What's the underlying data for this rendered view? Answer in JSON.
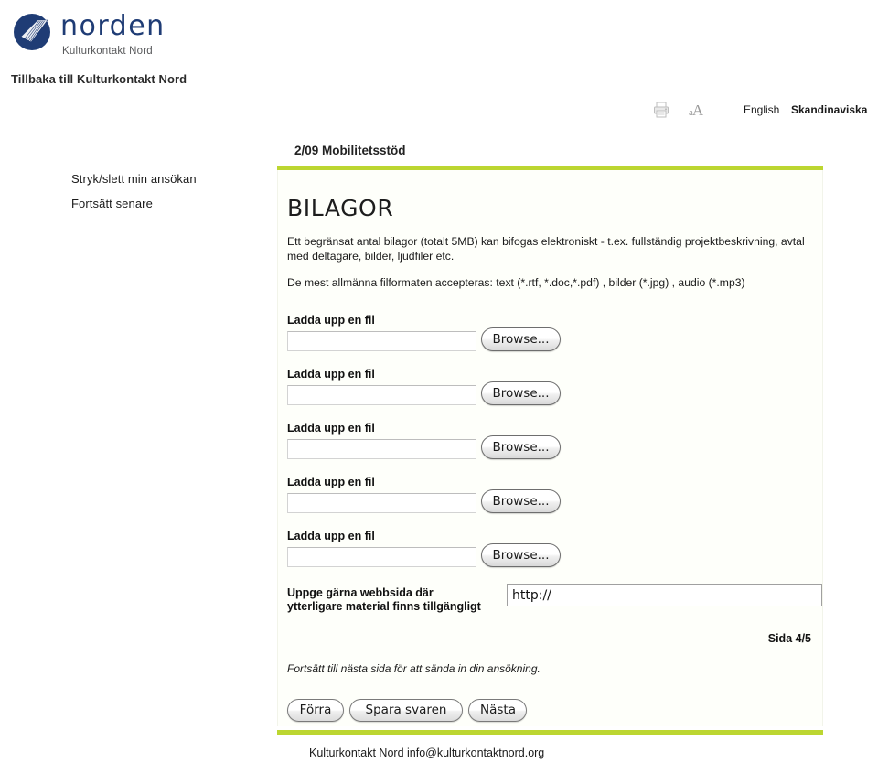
{
  "brand": {
    "wordmark": "norden",
    "subtitle": "Kulturkontakt Nord",
    "logo_icon": "norden-circle-logo",
    "logo_color": "#1f3c75"
  },
  "back_link": {
    "label": "Tillbaka till Kulturkontakt Nord"
  },
  "utility_bar": {
    "print_icon": "printer-icon",
    "textsize_icon": "text-size-icon",
    "textsize_small": "a",
    "textsize_large": "A",
    "languages": [
      {
        "label": "English",
        "active": false
      },
      {
        "label": "Skandinaviska",
        "active": true
      }
    ]
  },
  "form": {
    "title": "2/09 Mobilitetsstöd",
    "accent_color": "#bcd631"
  },
  "sidebar": {
    "items": [
      {
        "label": "Stryk/slett min ansökan"
      },
      {
        "label": "Fortsätt senare"
      }
    ]
  },
  "content": {
    "heading": "BILAGOR",
    "intro_1": "Ett begränsat antal bilagor (totalt 5MB) kan bifogas elektroniskt - t.ex. fullständig projektbeskrivning, avtal med deltagare, bilder, ljudfiler etc.",
    "intro_2": "De mest allmänna filformaten accepteras: text (*.rtf, *.doc,*.pdf) , bilder (*.jpg) , audio (*.mp3)",
    "uploads": [
      {
        "label": "Ladda upp en fil",
        "value": "",
        "browse_label": "Browse..."
      },
      {
        "label": "Ladda upp en fil",
        "value": "",
        "browse_label": "Browse..."
      },
      {
        "label": "Ladda upp en fil",
        "value": "",
        "browse_label": "Browse..."
      },
      {
        "label": "Ladda upp en fil",
        "value": "",
        "browse_label": "Browse..."
      },
      {
        "label": "Ladda upp en fil",
        "value": "",
        "browse_label": "Browse..."
      }
    ],
    "website": {
      "label": "Uppge gärna webbsida där ytterligare material finns tillgängligt",
      "value": "http://"
    },
    "page_counter": "Sida 4/5",
    "continue_note": "Fortsätt till nästa sida för att sända in din ansökning.",
    "buttons": {
      "previous": "Förra",
      "save": "Spara svaren",
      "next": "Nästa"
    }
  },
  "footer": {
    "text": "Kulturkontakt Nord  info@kulturkontaktnord.org"
  }
}
